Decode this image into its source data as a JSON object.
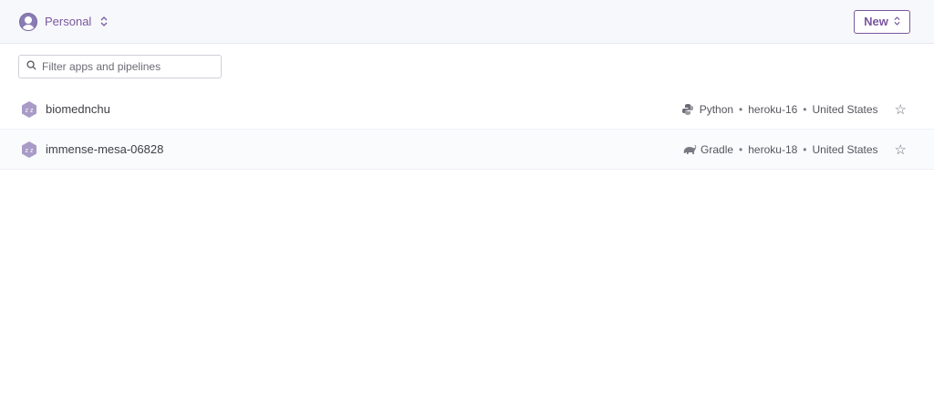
{
  "header": {
    "account_label": "Personal",
    "new_label": "New"
  },
  "filter": {
    "placeholder": "Filter apps and pipelines"
  },
  "apps": [
    {
      "name": "biomednchu",
      "language": "Python",
      "language_icon": "python-icon",
      "stack": "heroku-16",
      "region": "United States"
    },
    {
      "name": "immense-mesa-06828",
      "language": "Gradle",
      "language_icon": "gradle-icon",
      "stack": "heroku-18",
      "region": "United States"
    }
  ],
  "meta_separator": "•",
  "colors": {
    "accent": "#79589f",
    "header_bg": "#f7f8fb"
  }
}
